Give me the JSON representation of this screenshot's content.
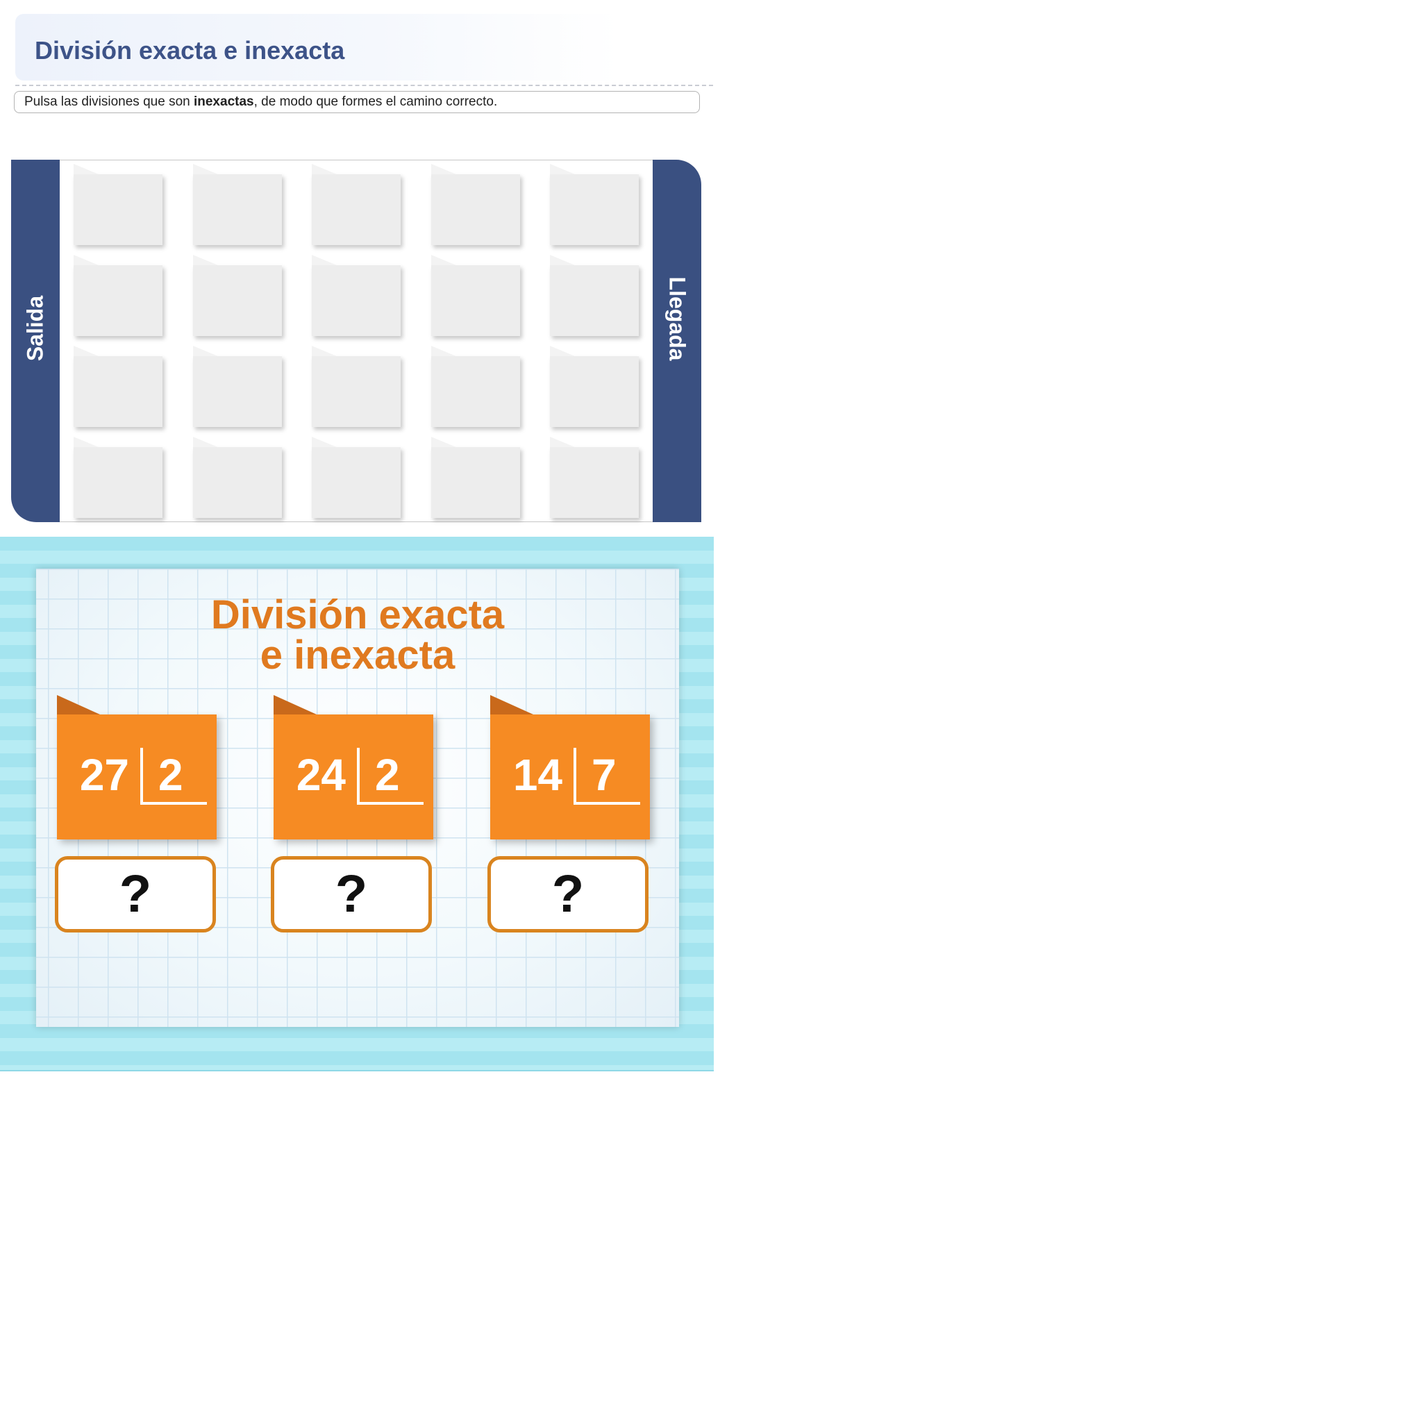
{
  "header": {
    "title": "División exacta e inexacta",
    "instruction_pre": "Pulsa las divisiones que son ",
    "instruction_bold": "inexactas",
    "instruction_post": ", de modo que formes el camino correcto."
  },
  "board": {
    "start_label": "Salida",
    "end_label": "Llegada",
    "rows": 4,
    "cols": 5
  },
  "preview": {
    "title_line1": "División exacta",
    "title_line2": "e inexacta",
    "divisions": [
      {
        "dividend": "27",
        "divisor": "2",
        "answer": "?"
      },
      {
        "dividend": "24",
        "divisor": "2",
        "answer": "?"
      },
      {
        "dividend": "14",
        "divisor": "7",
        "answer": "?"
      }
    ]
  },
  "colors": {
    "header_blue": "#3d5388",
    "side_bar": "#3a5081",
    "card_orange": "#f68b23",
    "title_orange": "#e07a1f",
    "answer_border": "#d9841f",
    "stripe_light": "#b7ecf4",
    "stripe_dark": "#a4e4ef"
  }
}
